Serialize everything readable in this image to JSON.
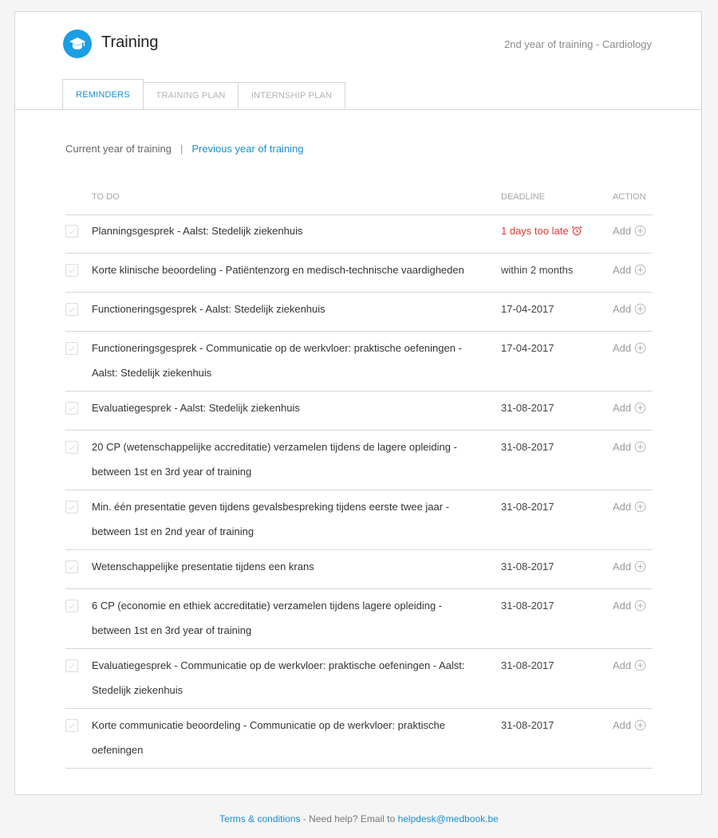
{
  "header": {
    "title": "Training",
    "year_info": "2nd year of training - Cardiology"
  },
  "tabs": [
    {
      "label": "REMINDERS",
      "active": true
    },
    {
      "label": "TRAINING PLAN",
      "active": false
    },
    {
      "label": "INTERNSHIP PLAN",
      "active": false
    }
  ],
  "subnav": {
    "current": "Current year of training",
    "separator": "|",
    "previous": "Previous year of training"
  },
  "table": {
    "headers": {
      "todo": "TO DO",
      "deadline": "DEADLINE",
      "action": "ACTION"
    },
    "rows": [
      {
        "todo": "Planningsgesprek - Aalst: Stedelijk ziekenhuis",
        "deadline": "1 days too late",
        "late": true,
        "action": "Add"
      },
      {
        "todo": "Korte klinische beoordeling - Patiëntenzorg en medisch-technische vaardigheden",
        "deadline": "within 2 months",
        "action": "Add"
      },
      {
        "todo": "Functioneringsgesprek - Aalst: Stedelijk ziekenhuis",
        "deadline": "17-04-2017",
        "action": "Add"
      },
      {
        "todo": "Functioneringsgesprek - Communicatie op de werkvloer: praktische oefeningen - Aalst: Stedelijk ziekenhuis",
        "deadline": "17-04-2017",
        "action": "Add"
      },
      {
        "todo": "Evaluatiegesprek - Aalst: Stedelijk ziekenhuis",
        "deadline": "31-08-2017",
        "action": "Add"
      },
      {
        "todo": "20 CP (wetenschappelijke accreditatie) verzamelen tijdens de lagere opleiding - between 1st en 3rd year of training",
        "deadline": "31-08-2017",
        "action": "Add"
      },
      {
        "todo": "Min. één presentatie geven tijdens gevalsbespreking tijdens eerste twee jaar - between 1st en 2nd year of training",
        "deadline": "31-08-2017",
        "action": "Add"
      },
      {
        "todo": "Wetenschappelijke presentatie tijdens een krans",
        "deadline": "31-08-2017",
        "action": "Add"
      },
      {
        "todo": "6 CP (economie en ethiek accreditatie) verzamelen tijdens lagere opleiding - between 1st en 3rd year of training",
        "deadline": "31-08-2017",
        "action": "Add"
      },
      {
        "todo": "Evaluatiegesprek - Communicatie op de werkvloer: praktische oefeningen - Aalst: Stedelijk ziekenhuis",
        "deadline": "31-08-2017",
        "action": "Add"
      },
      {
        "todo": "Korte communicatie beoordeling - Communicatie op de werkvloer: praktische oefeningen",
        "deadline": "31-08-2017",
        "action": "Add"
      }
    ]
  },
  "footer": {
    "terms": "Terms & conditions",
    "help": " - Need help? Email to ",
    "email": "helpdesk@medbook.be"
  },
  "colors": {
    "accent": "#1a8fd1",
    "logo": "#1a9ee4",
    "late": "#e53935"
  },
  "icons": {
    "logo": "graduation-cap-icon",
    "late": "alarm-clock-icon",
    "action": "plus-circle-icon",
    "row": "checkmark-icon"
  }
}
